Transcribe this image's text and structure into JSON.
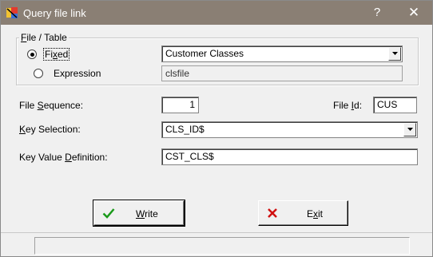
{
  "window": {
    "title": "Query file link",
    "help_glyph": "?",
    "close_glyph": "✕"
  },
  "file_table": {
    "group_label_accel": "F",
    "group_label_rest": "ile / Table",
    "fixed_label": "Fixed",
    "fixed_accel": "x",
    "fixed_selected": true,
    "fixed_value": "Customer Classes",
    "expression_label": "Expression",
    "expression_value": "clsfile"
  },
  "file_sequence": {
    "label_pre": "File ",
    "label_accel": "S",
    "label_post": "equence:",
    "value": "1"
  },
  "file_id": {
    "label_pre": "File ",
    "label_accel": "I",
    "label_post": "d:",
    "value": "CUS"
  },
  "key_selection": {
    "label_accel": "K",
    "label_post": "ey Selection:",
    "value": "CLS_ID$"
  },
  "key_value": {
    "label_pre": "Key Value ",
    "label_accel": "D",
    "label_post": "efinition:",
    "value": "CST_CLS$"
  },
  "buttons": {
    "write_accel": "W",
    "write_rest": "rite",
    "exit_pre": "E",
    "exit_accel": "x",
    "exit_post": "it"
  },
  "status": {
    "text": ""
  },
  "colors": {
    "titlebar": "#8a7f74",
    "check_green": "#1a9a1a",
    "exit_red": "#d01010"
  }
}
